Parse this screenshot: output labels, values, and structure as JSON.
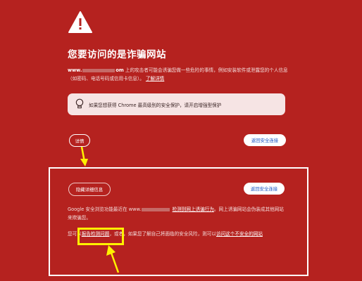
{
  "page": {
    "title": "您要访问的是诈骗网站",
    "desc_domain_prefix": "www.",
    "desc_domain_suffix": "om",
    "desc_text": "上的攻击者可能会诱骗您做一些危险的事情，例如安装软件或泄露您的个人信息（如密码、电话号码或信用卡信息）。",
    "desc_link": "了解详情",
    "tip": "如果您想获得 Chrome 最高级别的安全保护，请开启增强型保护",
    "details_button": "详情",
    "back_button": "返回安全连接",
    "hide_details_button": "隐藏详细信息",
    "back_button_2": "返回安全连接",
    "p1_prefix": "Google 安全浏览功能最近在 www.",
    "p1_link": "检测到网上诱骗行为",
    "p1_suffix": "。网上诱骗网站会伪装成其他网站来欺骗您。",
    "p2_prefix": "您可以",
    "p2_link1": "报告检测问题",
    "p2_middle": "，或者，如果您了解自己将面临的安全风险，则可以",
    "p2_link2": "访问这个不安全的网站"
  },
  "colors": {
    "background": "#b5221f",
    "highlight": "#fff200",
    "link_blue": "#1a56c4"
  },
  "icons": [
    "warning-triangle-icon",
    "lightbulb-icon",
    "annotation-arrow-icon"
  ]
}
